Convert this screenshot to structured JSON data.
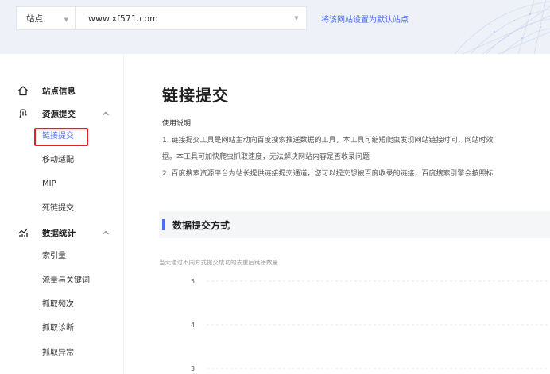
{
  "header": {
    "site_label": "站点",
    "site_value": "www.xf571.com",
    "set_default_link": "将该网站设置为默认站点"
  },
  "sidebar": {
    "groups": [
      {
        "label": "站点信息",
        "icon": "home-icon"
      },
      {
        "label": "资源提交",
        "icon": "submit-icon",
        "expanded": true,
        "items": [
          "链接提交",
          "移动适配",
          "MIP",
          "死链提交"
        ]
      },
      {
        "label": "数据统计",
        "icon": "stats-icon",
        "expanded": true,
        "items": [
          "索引量",
          "流量与关键词",
          "抓取频次",
          "抓取诊断",
          "抓取异常"
        ]
      }
    ],
    "active_item": "链接提交"
  },
  "main": {
    "title": "链接提交",
    "usage_title": "使用说明",
    "usage_lines": [
      "1. 链接提交工具是网站主动向百度搜索推送数据的工具，本工具可缩短爬虫发现网站链接时间，网站时效",
      "据。本工具可加快爬虫抓取速度，无法解决网站内容是否收录问题",
      "2. 百度搜索资源平台为站长提供链接提交通道，您可以提交想被百度收录的链接，百度搜索引擎会按照标"
    ],
    "section_title": "数据提交方式",
    "chart_caption": "当天通过不同方式提交成功的去重后链接数量"
  },
  "chart_data": {
    "type": "line",
    "yticks": [
      5,
      4,
      3
    ],
    "grid": true
  },
  "colors": {
    "accent": "#4e6ef2",
    "highlight_border": "#e02020"
  }
}
